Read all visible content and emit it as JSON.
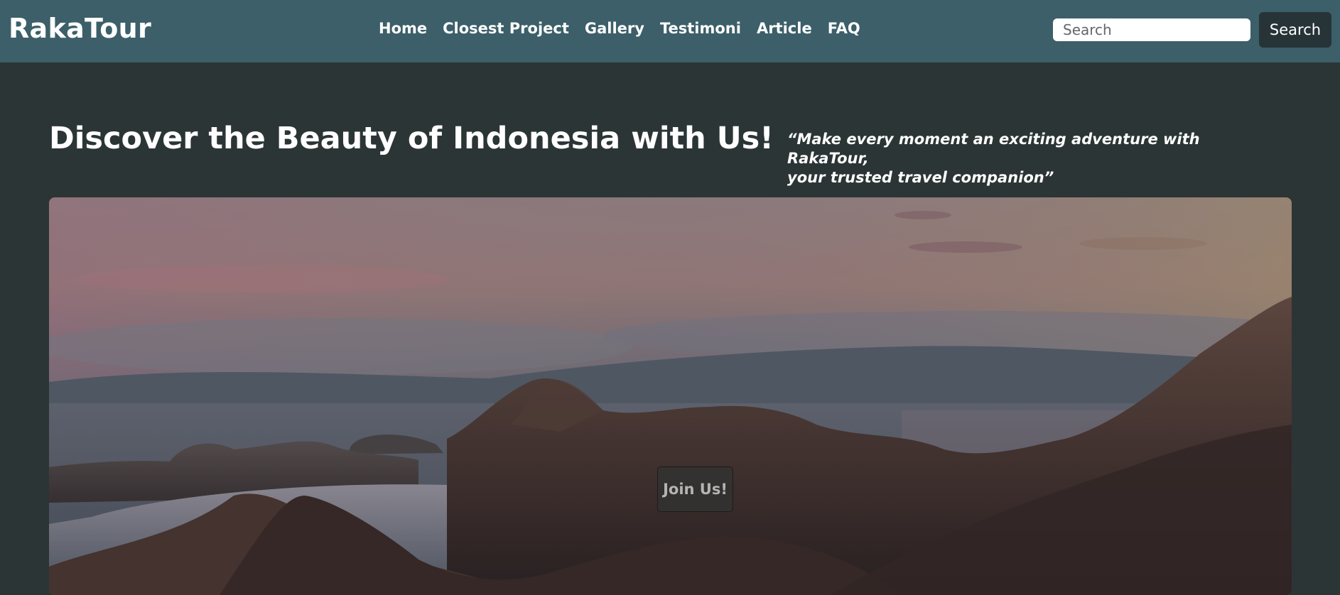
{
  "header": {
    "brand": "RakaTour",
    "nav": [
      {
        "label": "Home"
      },
      {
        "label": "Closest Project"
      },
      {
        "label": "Gallery"
      },
      {
        "label": "Testimoni"
      },
      {
        "label": "Article"
      },
      {
        "label": "FAQ"
      }
    ],
    "search": {
      "placeholder": "Search",
      "value": "",
      "button_label": "Search"
    }
  },
  "hero": {
    "title": "Discover the Beauty of Indonesia with Us!",
    "quote_line1": "“Make every moment an exciting adventure with RakaTour,",
    "quote_line2": "your trusted travel companion”",
    "cta_label": "Join Us!"
  },
  "colors": {
    "navbar": "#3c5f69",
    "page_background": "#2c3535",
    "search_button": "#263438"
  }
}
